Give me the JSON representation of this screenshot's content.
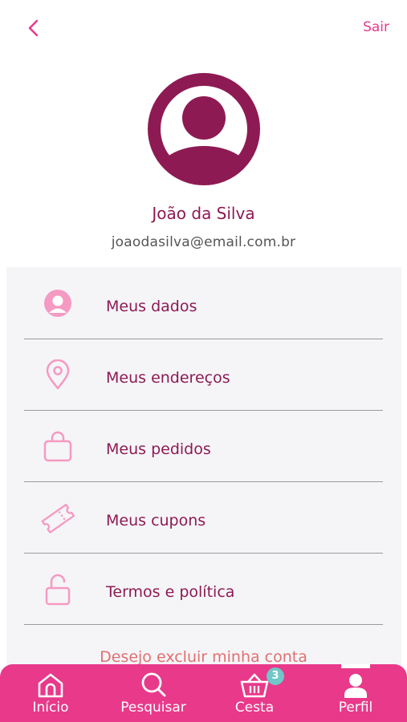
{
  "header": {
    "back_icon": "chevron-left-icon",
    "logout_label": "Sair"
  },
  "profile": {
    "avatar_icon": "user-avatar-icon",
    "name": "João da Silva",
    "email": "joaodasilva@email.com.br"
  },
  "menu": {
    "items": [
      {
        "label": "Meus dados",
        "icon": "user-circle-icon"
      },
      {
        "label": "Meus endereços",
        "icon": "location-pin-icon"
      },
      {
        "label": "Meus pedidos",
        "icon": "shopping-bag-icon"
      },
      {
        "label": "Meus cupons",
        "icon": "ticket-icon"
      },
      {
        "label": "Termos e política",
        "icon": "unlock-icon"
      }
    ],
    "delete_label": "Desejo excluir minha conta"
  },
  "bottom_nav": {
    "items": [
      {
        "label": "Início",
        "icon": "home-icon"
      },
      {
        "label": "Pesquisar",
        "icon": "search-icon"
      },
      {
        "label": "Cesta",
        "icon": "basket-icon",
        "badge": "3"
      },
      {
        "label": "Perfil",
        "icon": "user-icon",
        "active": true
      }
    ]
  },
  "colors": {
    "accent": "#e8398a",
    "brand_dark": "#8e1a54",
    "badge": "#6fc7c9",
    "panel_bg": "#f5f5f8"
  }
}
